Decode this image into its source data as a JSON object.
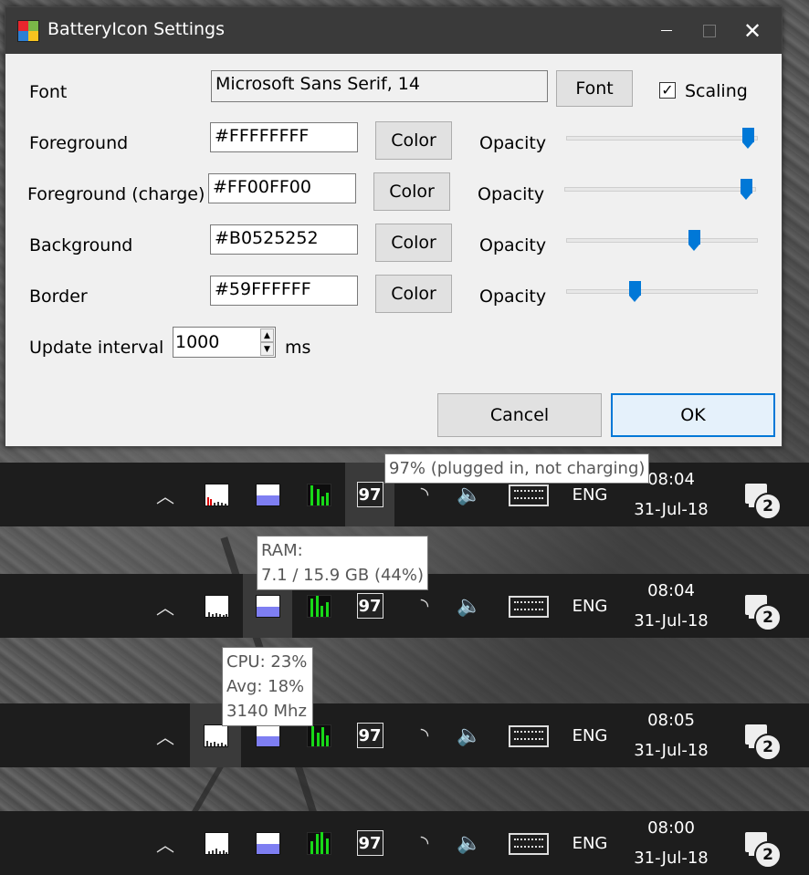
{
  "dialog": {
    "title": "BatteryIcon Settings",
    "font_label": "Font",
    "font_value": "Microsoft Sans Serif, 14",
    "font_button": "Font",
    "scaling_label": "Scaling",
    "scaling_checked": true,
    "rows": [
      {
        "label": "Foreground",
        "value": "#FFFFFFFF",
        "color_button": "Color",
        "opacity_label": "Opacity",
        "opacity": 0.95
      },
      {
        "label": "Foreground (charge)",
        "value": "#FF00FF00",
        "color_button": "Color",
        "opacity_label": "Opacity",
        "opacity": 0.95
      },
      {
        "label": "Background",
        "value": "#B0525252",
        "color_button": "Color",
        "opacity_label": "Opacity",
        "opacity": 0.67
      },
      {
        "label": "Border",
        "value": "#59FFFFFF",
        "color_button": "Color",
        "opacity_label": "Opacity",
        "opacity": 0.36
      }
    ],
    "update_interval_label": "Update interval",
    "update_interval_value": "1000",
    "update_interval_unit": "ms",
    "cancel_button": "Cancel",
    "ok_button": "OK"
  },
  "taskbars": [
    {
      "battery": "97",
      "lang": "ENG",
      "time": "08:04",
      "date": "31-Jul-18",
      "notifications": "2"
    },
    {
      "battery": "97",
      "lang": "ENG",
      "time": "08:04",
      "date": "31-Jul-18",
      "notifications": "2"
    },
    {
      "battery": "97",
      "lang": "ENG",
      "time": "08:05",
      "date": "31-Jul-18",
      "notifications": "2"
    },
    {
      "battery": "97",
      "lang": "ENG",
      "time": "08:00",
      "date": "31-Jul-18",
      "notifications": "2"
    }
  ],
  "tooltips": {
    "battery": "97% (plugged in, not charging)",
    "ram_title": "RAM:",
    "ram_value": "7.1 / 15.9 GB (44%)",
    "cpu": "CPU: 23%",
    "avg": "Avg: 18%",
    "mhz": "3140 Mhz"
  },
  "icons": {
    "tray_expand": "chevron-up-icon",
    "cpu_graph": "cpu-graph-icon",
    "ram_meter": "ram-meter-icon",
    "network_graph": "network-graph-icon",
    "battery": "battery-icon",
    "wifi": "wifi-icon",
    "volume": "volume-icon",
    "keyboard": "keyboard-icon",
    "action_center": "action-center-icon"
  },
  "colors": {
    "accent": "#0078d7",
    "ram_fill": "#7e7ef2",
    "net_bars": "#18d818",
    "taskbar": "#1d1d1d"
  }
}
